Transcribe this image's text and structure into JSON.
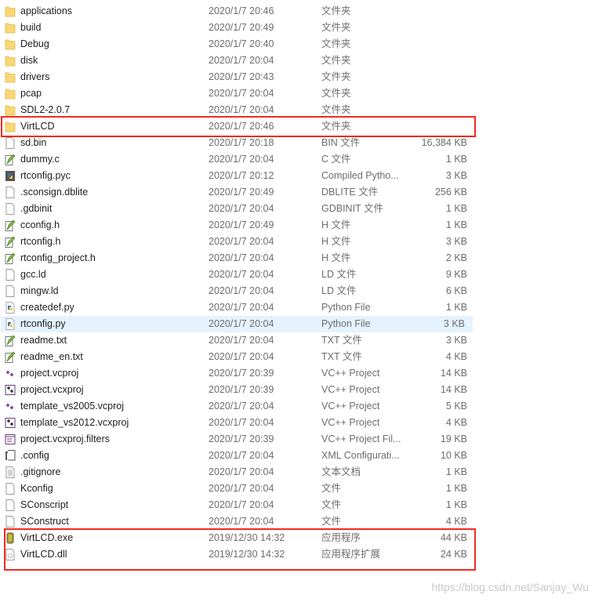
{
  "accent_colors": {
    "highlight": "#e5f3ff",
    "annotation": "#f02a20"
  },
  "files": [
    {
      "name": "applications",
      "date": "2020/1/7 20:46",
      "type": "文件夹",
      "size": "",
      "icon": "folder"
    },
    {
      "name": "build",
      "date": "2020/1/7 20:49",
      "type": "文件夹",
      "size": "",
      "icon": "folder"
    },
    {
      "name": "Debug",
      "date": "2020/1/7 20:40",
      "type": "文件夹",
      "size": "",
      "icon": "folder"
    },
    {
      "name": "disk",
      "date": "2020/1/7 20:04",
      "type": "文件夹",
      "size": "",
      "icon": "folder"
    },
    {
      "name": "drivers",
      "date": "2020/1/7 20:43",
      "type": "文件夹",
      "size": "",
      "icon": "folder"
    },
    {
      "name": "pcap",
      "date": "2020/1/7 20:04",
      "type": "文件夹",
      "size": "",
      "icon": "folder"
    },
    {
      "name": "SDL2-2.0.7",
      "date": "2020/1/7 20:04",
      "type": "文件夹",
      "size": "",
      "icon": "folder"
    },
    {
      "name": "VirtLCD",
      "date": "2020/1/7 20:46",
      "type": "文件夹",
      "size": "",
      "icon": "folder"
    },
    {
      "name": "sd.bin",
      "date": "2020/1/7 20:18",
      "type": "BIN 文件",
      "size": "16,384 KB",
      "icon": "file"
    },
    {
      "name": "dummy.c",
      "date": "2020/1/7 20:04",
      "type": "C 文件",
      "size": "1 KB",
      "icon": "source"
    },
    {
      "name": "rtconfig.pyc",
      "date": "2020/1/7 20:12",
      "type": "Compiled Pytho...",
      "size": "3 KB",
      "icon": "python-compiled"
    },
    {
      "name": ".sconsign.dblite",
      "date": "2020/1/7 20:49",
      "type": "DBLITE 文件",
      "size": "256 KB",
      "icon": "file"
    },
    {
      "name": ".gdbinit",
      "date": "2020/1/7 20:04",
      "type": "GDBINIT 文件",
      "size": "1 KB",
      "icon": "file"
    },
    {
      "name": "cconfig.h",
      "date": "2020/1/7 20:49",
      "type": "H 文件",
      "size": "1 KB",
      "icon": "source"
    },
    {
      "name": "rtconfig.h",
      "date": "2020/1/7 20:04",
      "type": "H 文件",
      "size": "3 KB",
      "icon": "source"
    },
    {
      "name": "rtconfig_project.h",
      "date": "2020/1/7 20:04",
      "type": "H 文件",
      "size": "2 KB",
      "icon": "source"
    },
    {
      "name": "gcc.ld",
      "date": "2020/1/7 20:04",
      "type": "LD 文件",
      "size": "9 KB",
      "icon": "file"
    },
    {
      "name": "mingw.ld",
      "date": "2020/1/7 20:04",
      "type": "LD 文件",
      "size": "6 KB",
      "icon": "file"
    },
    {
      "name": "createdef.py",
      "date": "2020/1/7 20:04",
      "type": "Python File",
      "size": "1 KB",
      "icon": "python"
    },
    {
      "name": "rtconfig.py",
      "date": "2020/1/7 20:04",
      "type": "Python File",
      "size": "3 KB",
      "icon": "python",
      "hover": true
    },
    {
      "name": "readme.txt",
      "date": "2020/1/7 20:04",
      "type": "TXT 文件",
      "size": "3 KB",
      "icon": "source"
    },
    {
      "name": "readme_en.txt",
      "date": "2020/1/7 20:04",
      "type": "TXT 文件",
      "size": "4 KB",
      "icon": "source"
    },
    {
      "name": "project.vcproj",
      "date": "2020/1/7 20:39",
      "type": "VC++ Project",
      "size": "14 KB",
      "icon": "vcproj"
    },
    {
      "name": "project.vcxproj",
      "date": "2020/1/7 20:39",
      "type": "VC++ Project",
      "size": "14 KB",
      "icon": "vcxproj"
    },
    {
      "name": "template_vs2005.vcproj",
      "date": "2020/1/7 20:04",
      "type": "VC++ Project",
      "size": "5 KB",
      "icon": "vcproj"
    },
    {
      "name": "template_vs2012.vcxproj",
      "date": "2020/1/7 20:04",
      "type": "VC++ Project",
      "size": "4 KB",
      "icon": "vcxproj"
    },
    {
      "name": "project.vcxproj.filters",
      "date": "2020/1/7 20:39",
      "type": "VC++ Project Fil...",
      "size": "19 KB",
      "icon": "filters"
    },
    {
      "name": ".config",
      "date": "2020/1/7 20:04",
      "type": "XML Configurati...",
      "size": "10 KB",
      "icon": "xml-config"
    },
    {
      "name": ".gitignore",
      "date": "2020/1/7 20:04",
      "type": "文本文档",
      "size": "1 KB",
      "icon": "text"
    },
    {
      "name": "Kconfig",
      "date": "2020/1/7 20:04",
      "type": "文件",
      "size": "1 KB",
      "icon": "file"
    },
    {
      "name": "SConscript",
      "date": "2020/1/7 20:04",
      "type": "文件",
      "size": "1 KB",
      "icon": "file"
    },
    {
      "name": "SConstruct",
      "date": "2020/1/7 20:04",
      "type": "文件",
      "size": "4 KB",
      "icon": "file"
    },
    {
      "name": "VirtLCD.exe",
      "date": "2019/12/30 14:32",
      "type": "应用程序",
      "size": "44 KB",
      "icon": "exe"
    },
    {
      "name": "VirtLCD.dll",
      "date": "2019/12/30 14:32",
      "type": "应用程序扩展",
      "size": "24 KB",
      "icon": "dll"
    }
  ],
  "watermark": "https://blog.csdn.net/Sanjay_Wu"
}
